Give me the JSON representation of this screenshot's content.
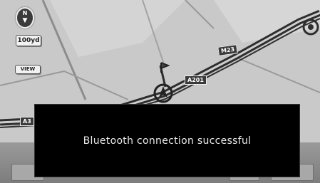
{
  "map": {
    "compass": {
      "letter": "N",
      "arrow": "▼"
    },
    "scale": {
      "label": "100yd"
    },
    "view_button": {
      "label": "VIEW"
    },
    "roads": {
      "a201": "A201",
      "m23": "M23",
      "a3": "A3"
    }
  },
  "notification": {
    "message": "Bluetooth connection successful"
  },
  "colors": {
    "map_background": "#c9c9c9",
    "road": "#2e2e2e",
    "notification_background": "#000000"
  }
}
